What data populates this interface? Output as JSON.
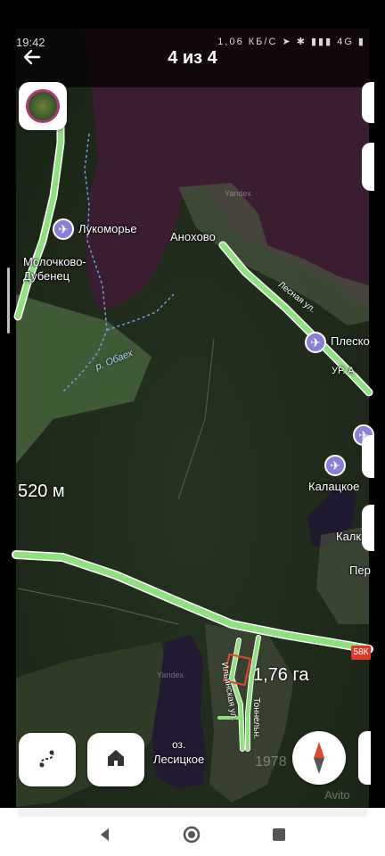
{
  "status_bar": {
    "time": "19:42",
    "signal_icons": "1,06 КБ/С ➤ ✱ ▮▮▮ 4G ▮"
  },
  "header": {
    "back_icon": "arrow-left-icon",
    "counter": "4 из 4"
  },
  "map": {
    "places": [
      {
        "name": "Лукоморье"
      },
      {
        "name": "Молочково-\nДубенец"
      },
      {
        "name": "Аноxово"
      },
      {
        "name": "Плеско"
      },
      {
        "name": "Калацкое"
      },
      {
        "name": "Калк"
      },
      {
        "name": "Пер"
      },
      {
        "name": "УР. А"
      }
    ],
    "water": {
      "river": "р. Обаех",
      "lake_prefix": "оз.",
      "lake_name": "Лесицкое"
    },
    "road_names": [
      "Лесная ул.",
      "Ильинская ул.",
      "Тоннельн."
    ],
    "road_badge": "58К",
    "scale_label": "520 м",
    "parcel_area": "1,76 га",
    "provider_marks": [
      "Yandex",
      "Yandex"
    ]
  },
  "controls": {
    "route_icon": "route-icon",
    "home_icon": "home-icon",
    "compass_icon": "compass-icon"
  },
  "watermark": {
    "brand": "Avito",
    "id": "1978"
  },
  "navbar": {
    "back": "nav-back-icon",
    "home": "nav-home-icon",
    "recent": "nav-recent-icon"
  },
  "colors": {
    "road": "#8fe07e",
    "water": "#3a1d31",
    "forest": "#1f2a1a",
    "poi": "#8a7fd6",
    "parcel": "#e0482c"
  }
}
